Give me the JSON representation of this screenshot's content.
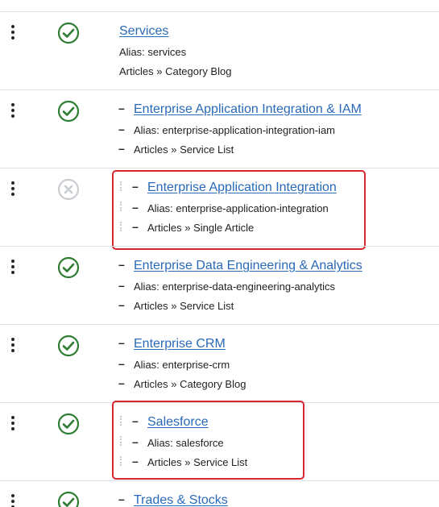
{
  "rows": [
    {
      "title": "Services",
      "alias": "Alias: services",
      "type": "Articles » Category Blog",
      "status": "published"
    },
    {
      "title": "Enterprise Application Integration & IAM",
      "alias": "Alias: enterprise-application-integration-iam",
      "type": "Articles » Service List",
      "status": "published"
    },
    {
      "title": "Enterprise Application Integration",
      "alias": "Alias: enterprise-application-integration",
      "type": "Articles » Single Article",
      "status": "unpublished"
    },
    {
      "title": "Enterprise Data Engineering & Analytics",
      "alias": "Alias: enterprise-data-engineering-analytics",
      "type": "Articles » Service List",
      "status": "published"
    },
    {
      "title": "Enterprise CRM",
      "alias": "Alias: enterprise-crm",
      "type": "Articles » Category Blog",
      "status": "published"
    },
    {
      "title": "Salesforce",
      "alias": "Alias: salesforce",
      "type": "Articles » Service List",
      "status": "published"
    },
    {
      "title": "Trades & Stocks",
      "alias": "",
      "type": "",
      "status": "published"
    }
  ],
  "glyphs": {
    "dash": "–"
  },
  "colors": {
    "link": "#2a69b8",
    "published": "#2e7d32",
    "unpublished": "#c9cdd2",
    "highlight": "#d7262d"
  },
  "icons": {
    "published": "check-circle-icon",
    "unpublished": "x-circle-icon",
    "drag": "vertical-dots-icon"
  }
}
